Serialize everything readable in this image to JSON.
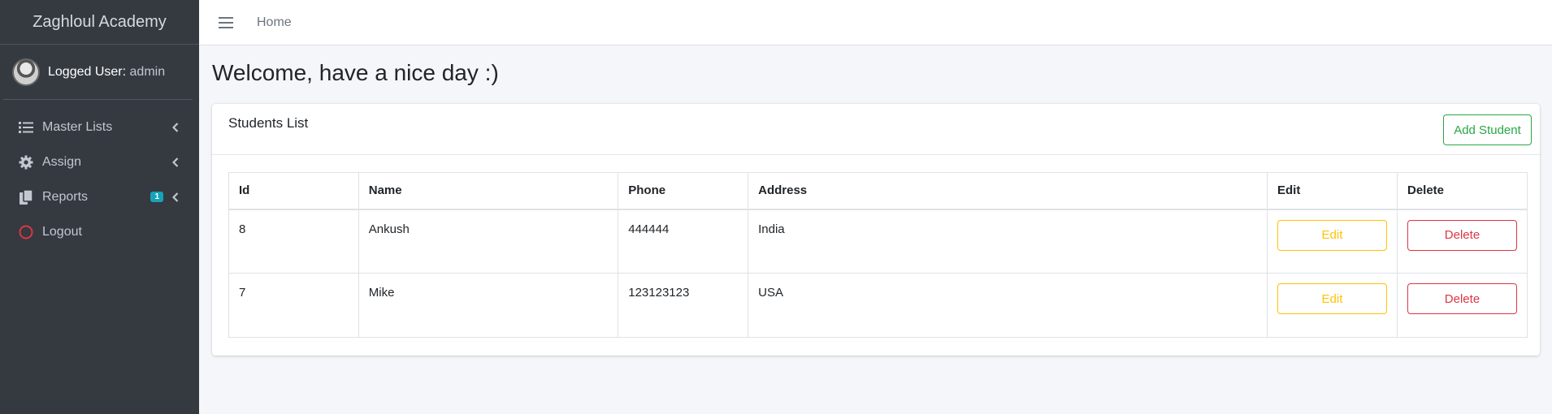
{
  "sidebar": {
    "brand": "Zaghloul Academy",
    "user_label": "Logged User:",
    "user_name": "admin",
    "items": [
      {
        "label": "Master Lists",
        "icon": "list-icon"
      },
      {
        "label": "Assign",
        "icon": "gear-icon"
      },
      {
        "label": "Reports",
        "icon": "copy-icon",
        "badge": "1"
      },
      {
        "label": "Logout",
        "icon": "circle-icon"
      }
    ]
  },
  "topbar": {
    "home": "Home"
  },
  "main": {
    "title": "Welcome, have a nice day :)",
    "card_title": "Students List",
    "add_button": "Add Student",
    "columns": [
      "Id",
      "Name",
      "Phone",
      "Address",
      "Edit",
      "Delete"
    ],
    "rows": [
      {
        "id": "8",
        "name": "Ankush",
        "phone": "444444",
        "address": "India",
        "edit": "Edit",
        "delete": "Delete"
      },
      {
        "id": "7",
        "name": "Mike",
        "phone": "123123123",
        "address": "USA",
        "edit": "Edit",
        "delete": "Delete"
      }
    ]
  },
  "colors": {
    "sidebar_bg": "#343a40",
    "success": "#28a745",
    "warning": "#ffc107",
    "danger": "#dc3545",
    "info": "#17a2b8"
  }
}
